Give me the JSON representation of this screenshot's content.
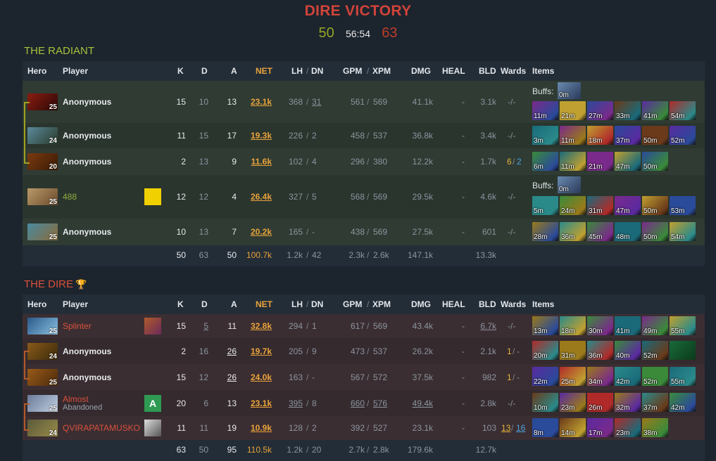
{
  "header": {
    "result": "DIRE VICTORY",
    "radiant_score": "50",
    "duration": "56:54",
    "dire_score": "63"
  },
  "columns": {
    "hero": "Hero",
    "player": "Player",
    "k": "K",
    "d": "D",
    "a": "A",
    "net": "NET",
    "lh": "LH",
    "dn": "DN",
    "gpm": "GPM",
    "xpm": "XPM",
    "dmg": "DMG",
    "heal": "HEAL",
    "bld": "BLD",
    "wards": "Wards",
    "items": "Items",
    "slash": "/"
  },
  "radiant": {
    "title": "THE RADIANT",
    "buffs_label": "Buffs:",
    "players": [
      {
        "level": "25",
        "name": "Anonymous",
        "k": "15",
        "d": "10",
        "a": "13",
        "net": "23.1k",
        "lh": "368",
        "dn": "31",
        "gpm": "561",
        "xpm": "569",
        "dmg": "41.1k",
        "heal": "-",
        "bld": "3.1k",
        "wards": "-/-",
        "buff": "0m",
        "items": [
          "11m",
          "21m",
          "27m",
          "33m",
          "41m",
          "54m"
        ]
      },
      {
        "level": "24",
        "name": "Anonymous",
        "k": "11",
        "d": "15",
        "a": "17",
        "net": "19.3k",
        "lh": "226",
        "dn": "2",
        "gpm": "458",
        "xpm": "537",
        "dmg": "36.8k",
        "heal": "-",
        "bld": "3.4k",
        "wards": "-/-",
        "items": [
          "3m",
          "11m",
          "18m",
          "37m",
          "50m",
          "52m"
        ]
      },
      {
        "level": "20",
        "name": "Anonymous",
        "k": "2",
        "d": "13",
        "a": "9",
        "net": "11.6k",
        "lh": "102",
        "dn": "4",
        "gpm": "296",
        "xpm": "380",
        "dmg": "12.2k",
        "heal": "-",
        "bld": "1.7k",
        "wards_a": "6",
        "wards_b": "2",
        "items": [
          "6m",
          "11m",
          "21m",
          "47m",
          "50m"
        ]
      },
      {
        "level": "25",
        "name": "488",
        "k": "12",
        "d": "12",
        "a": "4",
        "net": "26.4k",
        "lh": "327",
        "dn": "5",
        "gpm": "568",
        "xpm": "569",
        "dmg": "29.5k",
        "heal": "-",
        "bld": "4.6k",
        "wards": "-/-",
        "buff": "0m",
        "items": [
          "5m",
          "24m",
          "31m",
          "47m",
          "50m",
          "53m"
        ]
      },
      {
        "level": "25",
        "name": "Anonymous",
        "k": "10",
        "d": "13",
        "a": "7",
        "net": "20.2k",
        "lh": "165",
        "dn": "-",
        "gpm": "438",
        "xpm": "569",
        "dmg": "27.5k",
        "heal": "-",
        "bld": "601",
        "wards": "-/-",
        "items": [
          "28m",
          "36m",
          "45m",
          "48m",
          "50m",
          "54m"
        ]
      }
    ],
    "totals": {
      "k": "50",
      "d": "63",
      "a": "50",
      "net": "100.7k",
      "lh": "1.2k",
      "dn": "42",
      "gpm": "2.3k",
      "xpm": "2.6k",
      "dmg": "147.1k",
      "bld": "13.3k"
    }
  },
  "dire": {
    "title": "THE DIRE",
    "trophy_icon": "trophy-icon",
    "players": [
      {
        "level": "25",
        "name": "Splinter",
        "k": "15",
        "d": "5",
        "a": "11",
        "net": "32.8k",
        "lh": "294",
        "dn": "1",
        "gpm": "617",
        "xpm": "569",
        "dmg": "43.4k",
        "heal": "-",
        "bld": "6.7k",
        "wards": "-/-",
        "items": [
          "13m",
          "18m",
          "30m",
          "41m",
          "49m",
          "55m"
        ]
      },
      {
        "level": "24",
        "name": "Anonymous",
        "k": "2",
        "d": "16",
        "a": "26",
        "net": "19.7k",
        "lh": "205",
        "dn": "9",
        "gpm": "473",
        "xpm": "537",
        "dmg": "26.2k",
        "heal": "-",
        "bld": "2.1k",
        "wards_a": "1",
        "wards_b": "-",
        "items": [
          "20m",
          "31m",
          "36m",
          "40m",
          "52m",
          ""
        ]
      },
      {
        "level": "25",
        "name": "Anonymous",
        "k": "15",
        "d": "12",
        "a": "26",
        "net": "24.0k",
        "lh": "163",
        "dn": "-",
        "gpm": "567",
        "xpm": "572",
        "dmg": "37.5k",
        "heal": "-",
        "bld": "982",
        "wards_a": "1",
        "wards_b": "-",
        "items": [
          "22m",
          "25m",
          "34m",
          "42m",
          "52m",
          "55m"
        ]
      },
      {
        "level": "25",
        "name": "Almost",
        "status": "Abandoned",
        "badge": "A",
        "k": "20",
        "d": "6",
        "a": "13",
        "net": "23.1k",
        "lh": "395",
        "dn": "8",
        "gpm": "660",
        "xpm": "576",
        "dmg": "49.4k",
        "heal": "-",
        "bld": "2.8k",
        "wards": "-/-",
        "items": [
          "10m",
          "23m",
          "26m",
          "32m",
          "37m",
          "42m"
        ]
      },
      {
        "level": "24",
        "name": "QVIRAPATAMUSKO",
        "k": "11",
        "d": "11",
        "a": "19",
        "net": "10.9k",
        "lh": "128",
        "dn": "2",
        "gpm": "392",
        "xpm": "527",
        "dmg": "23.1k",
        "heal": "-",
        "bld": "103",
        "wards_a": "13",
        "wards_b": "16",
        "items": [
          "8m",
          "14m",
          "17m",
          "23m",
          "38m"
        ]
      }
    ],
    "totals": {
      "k": "63",
      "d": "50",
      "a": "95",
      "net": "110.5k",
      "lh": "1.2k",
      "dn": "20",
      "gpm": "2.7k",
      "xpm": "2.8k",
      "dmg": "179.6k",
      "bld": "12.7k"
    }
  },
  "colors": {
    "radiant": "#92a525",
    "dire": "#c23c2a",
    "net": "#e9a33b"
  }
}
